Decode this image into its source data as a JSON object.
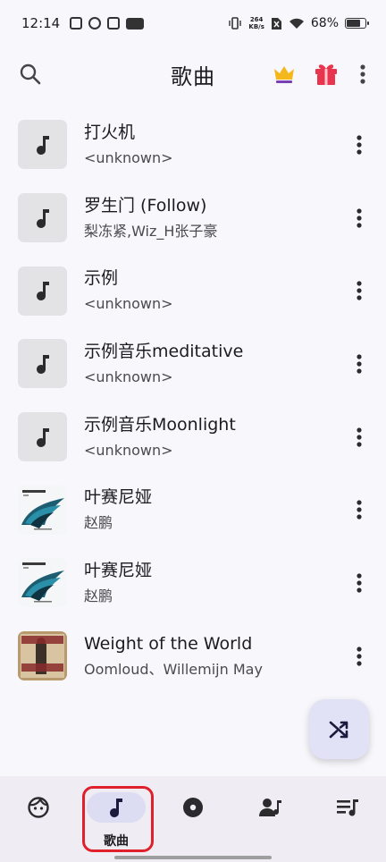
{
  "status": {
    "time": "12:14",
    "net_speed_value": "264",
    "net_speed_unit": "KB/s",
    "battery": "68%",
    "battery_fraction": 0.68
  },
  "app_bar": {
    "title": "歌曲",
    "icons": [
      "search-icon",
      "crown-icon",
      "gift-icon",
      "more-vert-icon"
    ]
  },
  "songs": [
    {
      "title": "打火机",
      "artist": "<unknown>",
      "art": "note"
    },
    {
      "title": "罗生门 (Follow)",
      "artist": "梨冻紧,Wiz_H张子豪",
      "art": "note"
    },
    {
      "title": "示例",
      "artist": "<unknown>",
      "art": "note"
    },
    {
      "title": "示例音乐meditative",
      "artist": "<unknown>",
      "art": "note"
    },
    {
      "title": "示例音乐Moonlight",
      "artist": "<unknown>",
      "art": "note"
    },
    {
      "title": "叶赛尼娅",
      "artist": "赵鹏",
      "art": "album-wing"
    },
    {
      "title": "叶赛尼娅",
      "artist": "赵鹏",
      "art": "album-wing"
    },
    {
      "title": "Weight of the World",
      "artist": "Oomloud、Willemijn May",
      "art": "album-weight"
    }
  ],
  "fab": {
    "icon": "shuffle-icon"
  },
  "bottom_nav": {
    "items": [
      {
        "icon": "face-icon",
        "label": ""
      },
      {
        "icon": "music-note-icon",
        "label": "歌曲",
        "active": true
      },
      {
        "icon": "album-icon",
        "label": ""
      },
      {
        "icon": "artist-icon",
        "label": ""
      },
      {
        "icon": "playlist-icon",
        "label": ""
      }
    ]
  },
  "colors": {
    "background": "#f8f7fc",
    "nav_background": "#efedf3",
    "active_pill": "#dcdcf3",
    "fab": "#e2e2f6",
    "highlight": "#e0202a"
  }
}
